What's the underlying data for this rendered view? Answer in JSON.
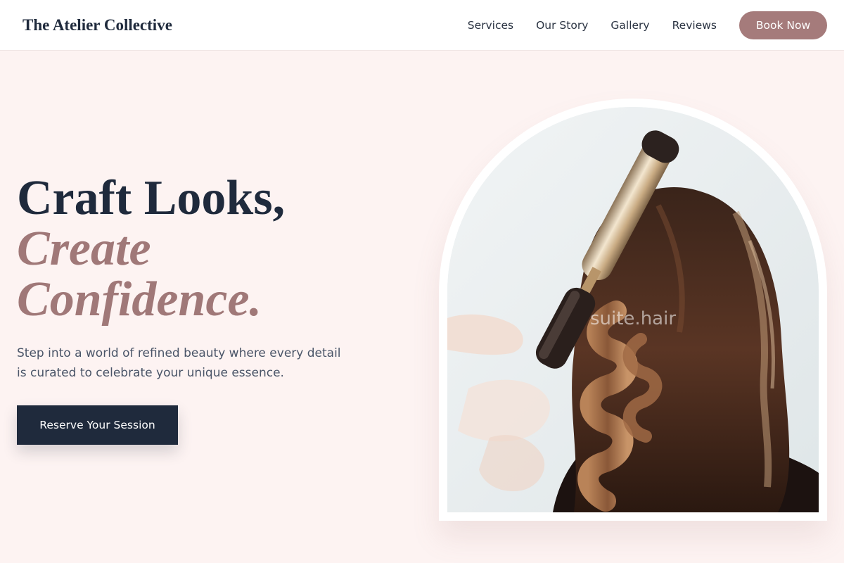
{
  "nav": {
    "brand": "The Atelier Collective",
    "links": [
      "Services",
      "Our Story",
      "Gallery",
      "Reviews"
    ],
    "cta": "Book Now"
  },
  "hero": {
    "title_line1": "Craft Looks,",
    "title_line2": "Create",
    "title_line3": "Confidence.",
    "subtitle": "Step into a world of refined beauty where every detail is curated to celebrate your unique essence.",
    "cta": "Reserve Your Session"
  },
  "image": {
    "subject": "stylist curling long brown hair with a curling iron",
    "watermark": "suite.hair"
  },
  "colors": {
    "background": "#fdf3f2",
    "navy": "#1f2a3c",
    "rose": "#a57b7b",
    "body_text": "#4a5568"
  }
}
